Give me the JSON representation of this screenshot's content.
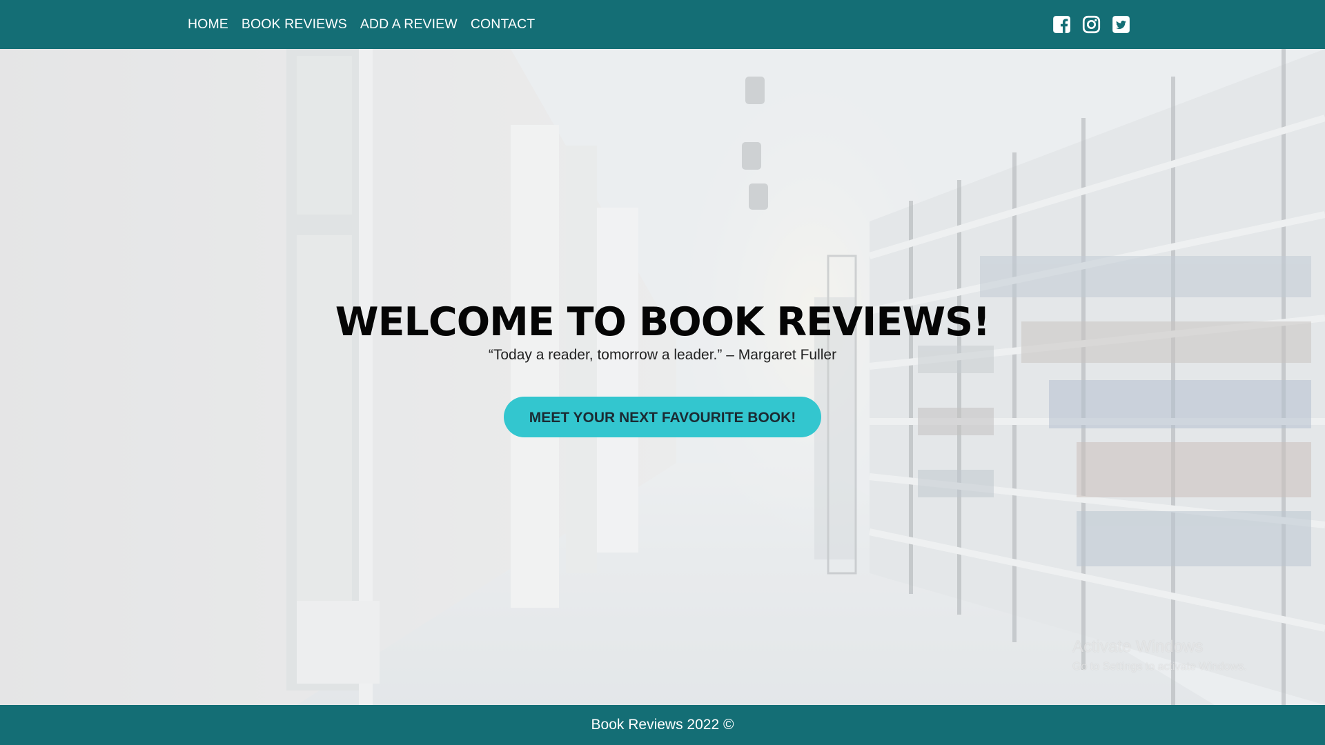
{
  "nav": {
    "links": [
      {
        "label": "HOME"
      },
      {
        "label": "BOOK REVIEWS"
      },
      {
        "label": "ADD A REVIEW"
      },
      {
        "label": "CONTACT"
      }
    ],
    "socials": [
      "facebook-icon",
      "instagram-icon",
      "twitter-icon"
    ]
  },
  "hero": {
    "title": "WELCOME TO BOOK REVIEWS!",
    "quote": "“Today a reader, tomorrow a leader.” – Margaret Fuller",
    "cta_label": "MEET YOUR NEXT FAVOURITE BOOK!"
  },
  "watermark": {
    "title": "Activate Windows",
    "subtitle": "Go to Settings to activate Windows."
  },
  "footer": {
    "text": "Book Reviews 2022 ©"
  },
  "colors": {
    "nav_background": "#146e75",
    "cta_background": "#33c6cf",
    "footer_background": "#146e75"
  }
}
